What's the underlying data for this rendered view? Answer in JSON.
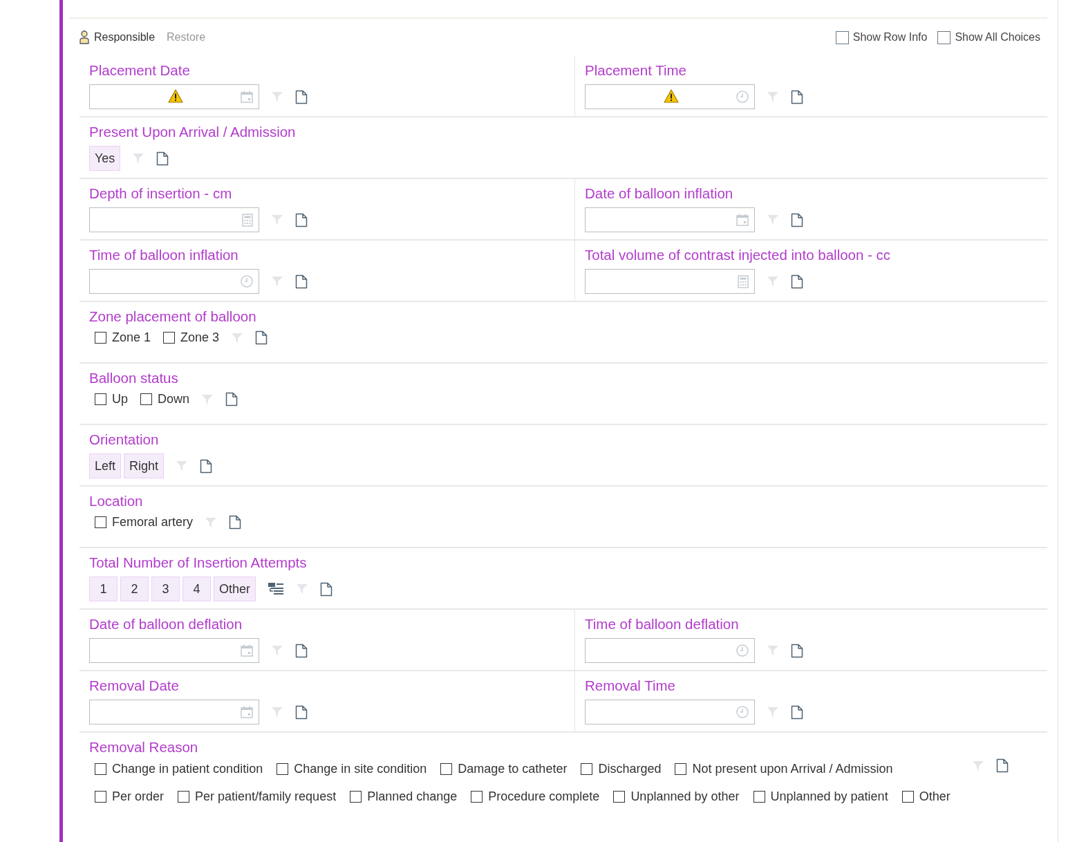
{
  "toolbar": {
    "responsible": "Responsible",
    "restore": "Restore",
    "toggles": [
      {
        "label": "Show Row Info",
        "checked": false
      },
      {
        "label": "Show All Choices",
        "checked": false
      }
    ]
  },
  "rows": [
    {
      "cells": [
        {
          "kind": "date",
          "label": "Placement Date",
          "warning": true
        },
        {
          "kind": "time",
          "label": "Placement Time",
          "warning": true
        }
      ]
    },
    {
      "cells": [
        {
          "kind": "buttons",
          "label": "Present Upon Arrival / Admission",
          "options": [
            {
              "label": "Yes",
              "selected": false
            }
          ]
        }
      ]
    },
    {
      "cells": [
        {
          "kind": "number",
          "label": "Depth of insertion - cm",
          "warning": false
        },
        {
          "kind": "date",
          "label": "Date of balloon inflation",
          "warning": false
        }
      ]
    },
    {
      "cells": [
        {
          "kind": "time",
          "label": "Time of balloon inflation",
          "warning": false
        },
        {
          "kind": "number",
          "label": "Total volume of contrast injected into balloon - cc",
          "warning": false
        }
      ]
    },
    {
      "cells": [
        {
          "kind": "checks",
          "label": "Zone placement of balloon",
          "options": [
            {
              "label": "Zone 1",
              "checked": false
            },
            {
              "label": "Zone 3",
              "checked": false
            }
          ]
        }
      ]
    },
    {
      "cells": [
        {
          "kind": "checks",
          "label": "Balloon status",
          "options": [
            {
              "label": "Up",
              "checked": false
            },
            {
              "label": "Down",
              "checked": false
            }
          ]
        }
      ]
    },
    {
      "cells": [
        {
          "kind": "buttons",
          "label": "Orientation",
          "options": [
            {
              "label": "Left",
              "selected": false
            },
            {
              "label": "Right",
              "selected": false
            }
          ]
        }
      ]
    },
    {
      "cells": [
        {
          "kind": "checks",
          "label": "Location",
          "options": [
            {
              "label": "Femoral artery",
              "checked": false
            }
          ]
        }
      ]
    },
    {
      "cells": [
        {
          "kind": "buttons",
          "label": "Total Number of Insertion Attempts",
          "list_button": true,
          "options": [
            {
              "label": "1",
              "selected": false
            },
            {
              "label": "2",
              "selected": false
            },
            {
              "label": "3",
              "selected": false
            },
            {
              "label": "4",
              "selected": false
            },
            {
              "label": "Other",
              "selected": false
            }
          ]
        }
      ]
    },
    {
      "cells": [
        {
          "kind": "date",
          "label": "Date of balloon deflation",
          "warning": false
        },
        {
          "kind": "time",
          "label": "Time of balloon deflation",
          "warning": false
        }
      ]
    },
    {
      "cells": [
        {
          "kind": "date",
          "label": "Removal Date",
          "warning": false
        },
        {
          "kind": "time",
          "label": "Removal Time",
          "warning": false
        }
      ]
    },
    {
      "cells": [
        {
          "kind": "checks",
          "label": "Removal Reason",
          "options": [
            {
              "label": "Change in patient condition",
              "checked": false
            },
            {
              "label": "Change in site condition",
              "checked": false
            },
            {
              "label": "Damage to catheter",
              "checked": false
            },
            {
              "label": "Discharged",
              "checked": false
            },
            {
              "label": "Not present upon Arrival / Admission",
              "checked": false
            },
            {
              "label": "Per order",
              "checked": false
            },
            {
              "label": "Per patient/family request",
              "checked": false
            },
            {
              "label": "Planned change",
              "checked": false
            },
            {
              "label": "Procedure complete",
              "checked": false
            },
            {
              "label": "Unplanned by other",
              "checked": false
            },
            {
              "label": "Unplanned by patient",
              "checked": false
            },
            {
              "label": "Other",
              "checked": false
            }
          ]
        }
      ]
    }
  ]
}
